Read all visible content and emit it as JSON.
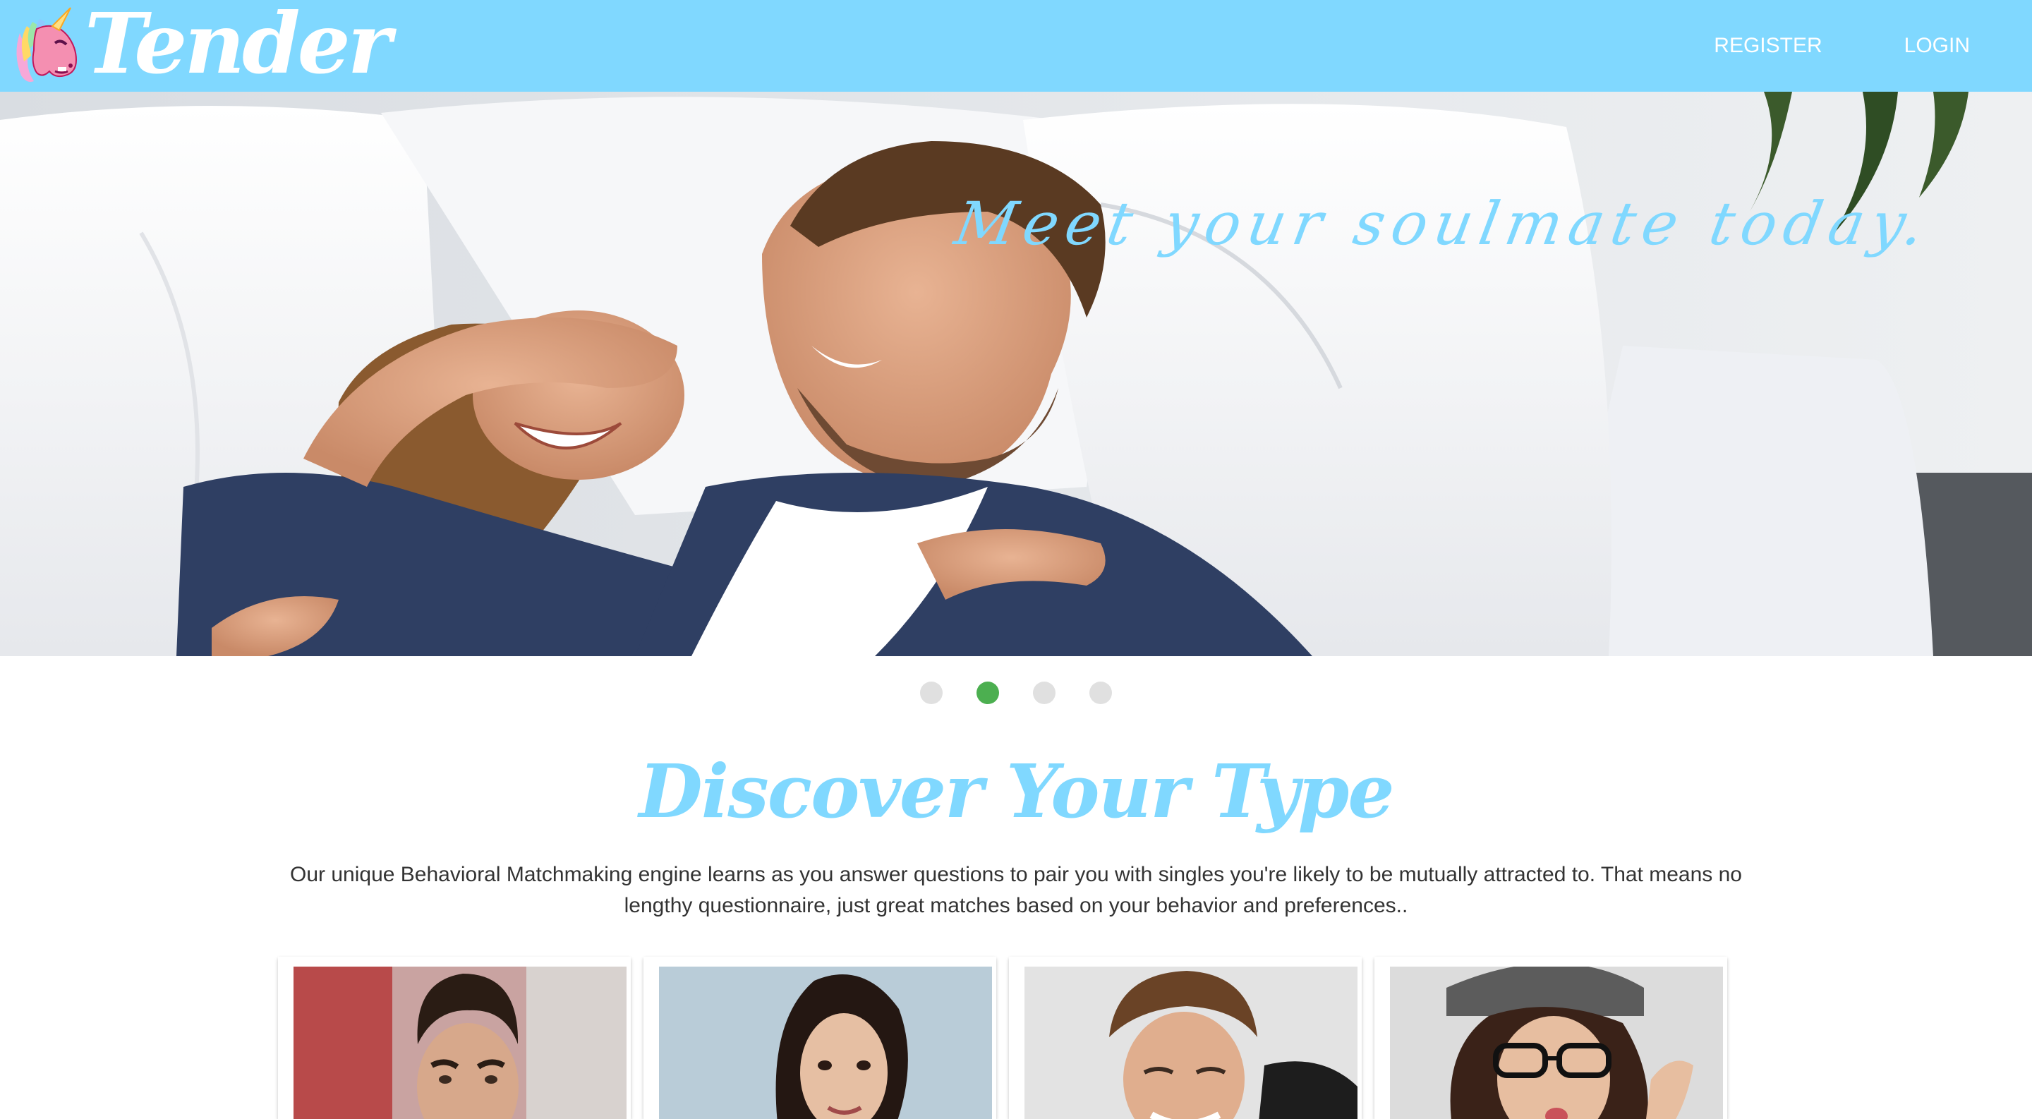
{
  "navbar": {
    "brand": "Tender",
    "links": [
      {
        "label": "REGISTER"
      },
      {
        "label": "LOGIN"
      }
    ]
  },
  "hero": {
    "caption": "Meet your soulmate today.",
    "slides_count": 4,
    "active_slide": 2
  },
  "discover": {
    "title": "Discover Your Type",
    "description": "Our unique Behavioral Matchmaking engine learns as you answer questions to pair you with singles you're likely to be mutually attracted to. That means no lengthy questionnaire, just great matches based on your behavior and preferences.."
  },
  "colors": {
    "navbar": "#80d8ff",
    "accent": "#80d8ff",
    "indicator_active": "#4caf50",
    "indicator_inactive": "#e0e0e0"
  }
}
